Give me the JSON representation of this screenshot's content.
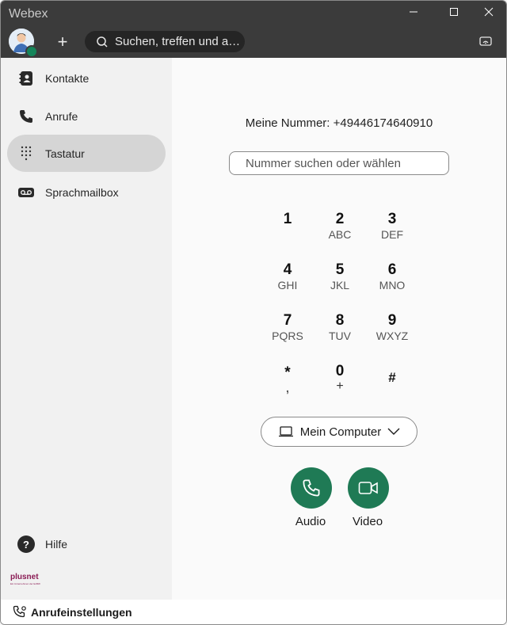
{
  "app": {
    "title": "Webex"
  },
  "header": {
    "search_placeholder": "Suchen, treffen und an...",
    "add_symbol": "+"
  },
  "sidebar": {
    "items": [
      {
        "label": "Kontakte",
        "icon": "contacts-icon"
      },
      {
        "label": "Anrufe",
        "icon": "phone-icon"
      },
      {
        "label": "Tastatur",
        "icon": "dialpad-icon",
        "active": true
      },
      {
        "label": "Sprachmailbox",
        "icon": "voicemail-icon"
      }
    ],
    "help_label": "Hilfe",
    "help_symbol": "?",
    "brand": {
      "name": "plusnet",
      "tagline": "Ein Unternehmen der EnBW"
    }
  },
  "dialer": {
    "my_number": "Meine Nummer: +49446174640910",
    "input_placeholder": "Nummer suchen oder wählen",
    "keys": [
      {
        "digit": "1",
        "letters": ""
      },
      {
        "digit": "2",
        "letters": "ABC"
      },
      {
        "digit": "3",
        "letters": "DEF"
      },
      {
        "digit": "4",
        "letters": "GHI"
      },
      {
        "digit": "5",
        "letters": "JKL"
      },
      {
        "digit": "6",
        "letters": "MNO"
      },
      {
        "digit": "7",
        "letters": "PQRS"
      },
      {
        "digit": "8",
        "letters": "TUV"
      },
      {
        "digit": "9",
        "letters": "WXYZ"
      },
      {
        "digit": "*",
        "letters": ","
      },
      {
        "digit": "0",
        "letters": "+"
      },
      {
        "digit": "#",
        "letters": ""
      }
    ],
    "device_label": "Mein Computer",
    "audio_label": "Audio",
    "video_label": "Video"
  },
  "footer": {
    "call_settings_label": "Anrufeinstellungen"
  },
  "colors": {
    "titlebar": "#3b3b3b",
    "accent_green": "#1f7a55",
    "active_nav": "#d5d5d5",
    "brand": "#8a1b54"
  }
}
